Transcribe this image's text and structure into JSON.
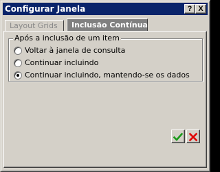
{
  "window": {
    "title": "Configurar Janela",
    "help_button": "?",
    "close_button": "X"
  },
  "tabs": [
    {
      "label": "Layout Grids",
      "active": false
    },
    {
      "label": "Inclusão Contínua",
      "active": true
    }
  ],
  "group": {
    "legend": "Após a inclusão de um item",
    "options": [
      {
        "label": "Voltar à janela de consulta",
        "checked": false
      },
      {
        "label": "Continuar incluindo",
        "checked": false
      },
      {
        "label": "Continuar incluindo, mantendo-se os dados",
        "checked": true
      }
    ]
  },
  "buttons": {
    "ok_icon": "green-check-icon",
    "cancel_icon": "red-x-icon"
  },
  "colors": {
    "titlebar": "#0a246a",
    "active_tab": "#808080",
    "face": "#d4d0c8",
    "ok": "#1a9a1a",
    "cancel": "#e00000"
  }
}
